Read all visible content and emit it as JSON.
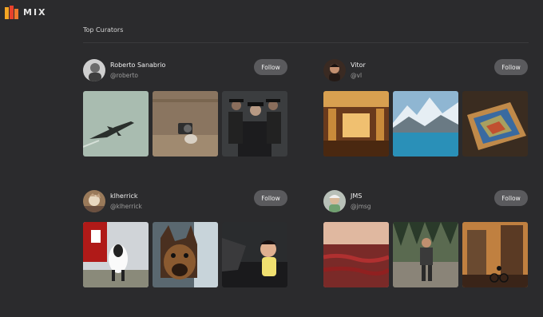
{
  "app": {
    "logo_text": "MIX"
  },
  "section": {
    "title": "Top Curators"
  },
  "follow_label": "Follow",
  "curators": [
    {
      "name": "Roberto Sanabrio",
      "handle": "@roberto",
      "thumbs": [
        "fighter-jet",
        "dog-with-camera",
        "men-in-hats"
      ]
    },
    {
      "name": "Vitor",
      "handle": "@vl",
      "thumbs": [
        "ornate-library",
        "mountain-lake",
        "relief-map-table"
      ]
    },
    {
      "name": "klherrick",
      "handle": "@klherrick",
      "thumbs": [
        "cow-and-barn",
        "german-shepherd",
        "child-in-car"
      ]
    },
    {
      "name": "JMS",
      "handle": "@jmsg",
      "thumbs": [
        "red-tide-sea",
        "hiker-on-rocks",
        "cyclist-at-sunset"
      ]
    }
  ],
  "colors": {
    "background": "#2b2b2d",
    "button": "#5a5a5d",
    "logo_red": "#e8412c",
    "logo_orange": "#f5a623"
  }
}
